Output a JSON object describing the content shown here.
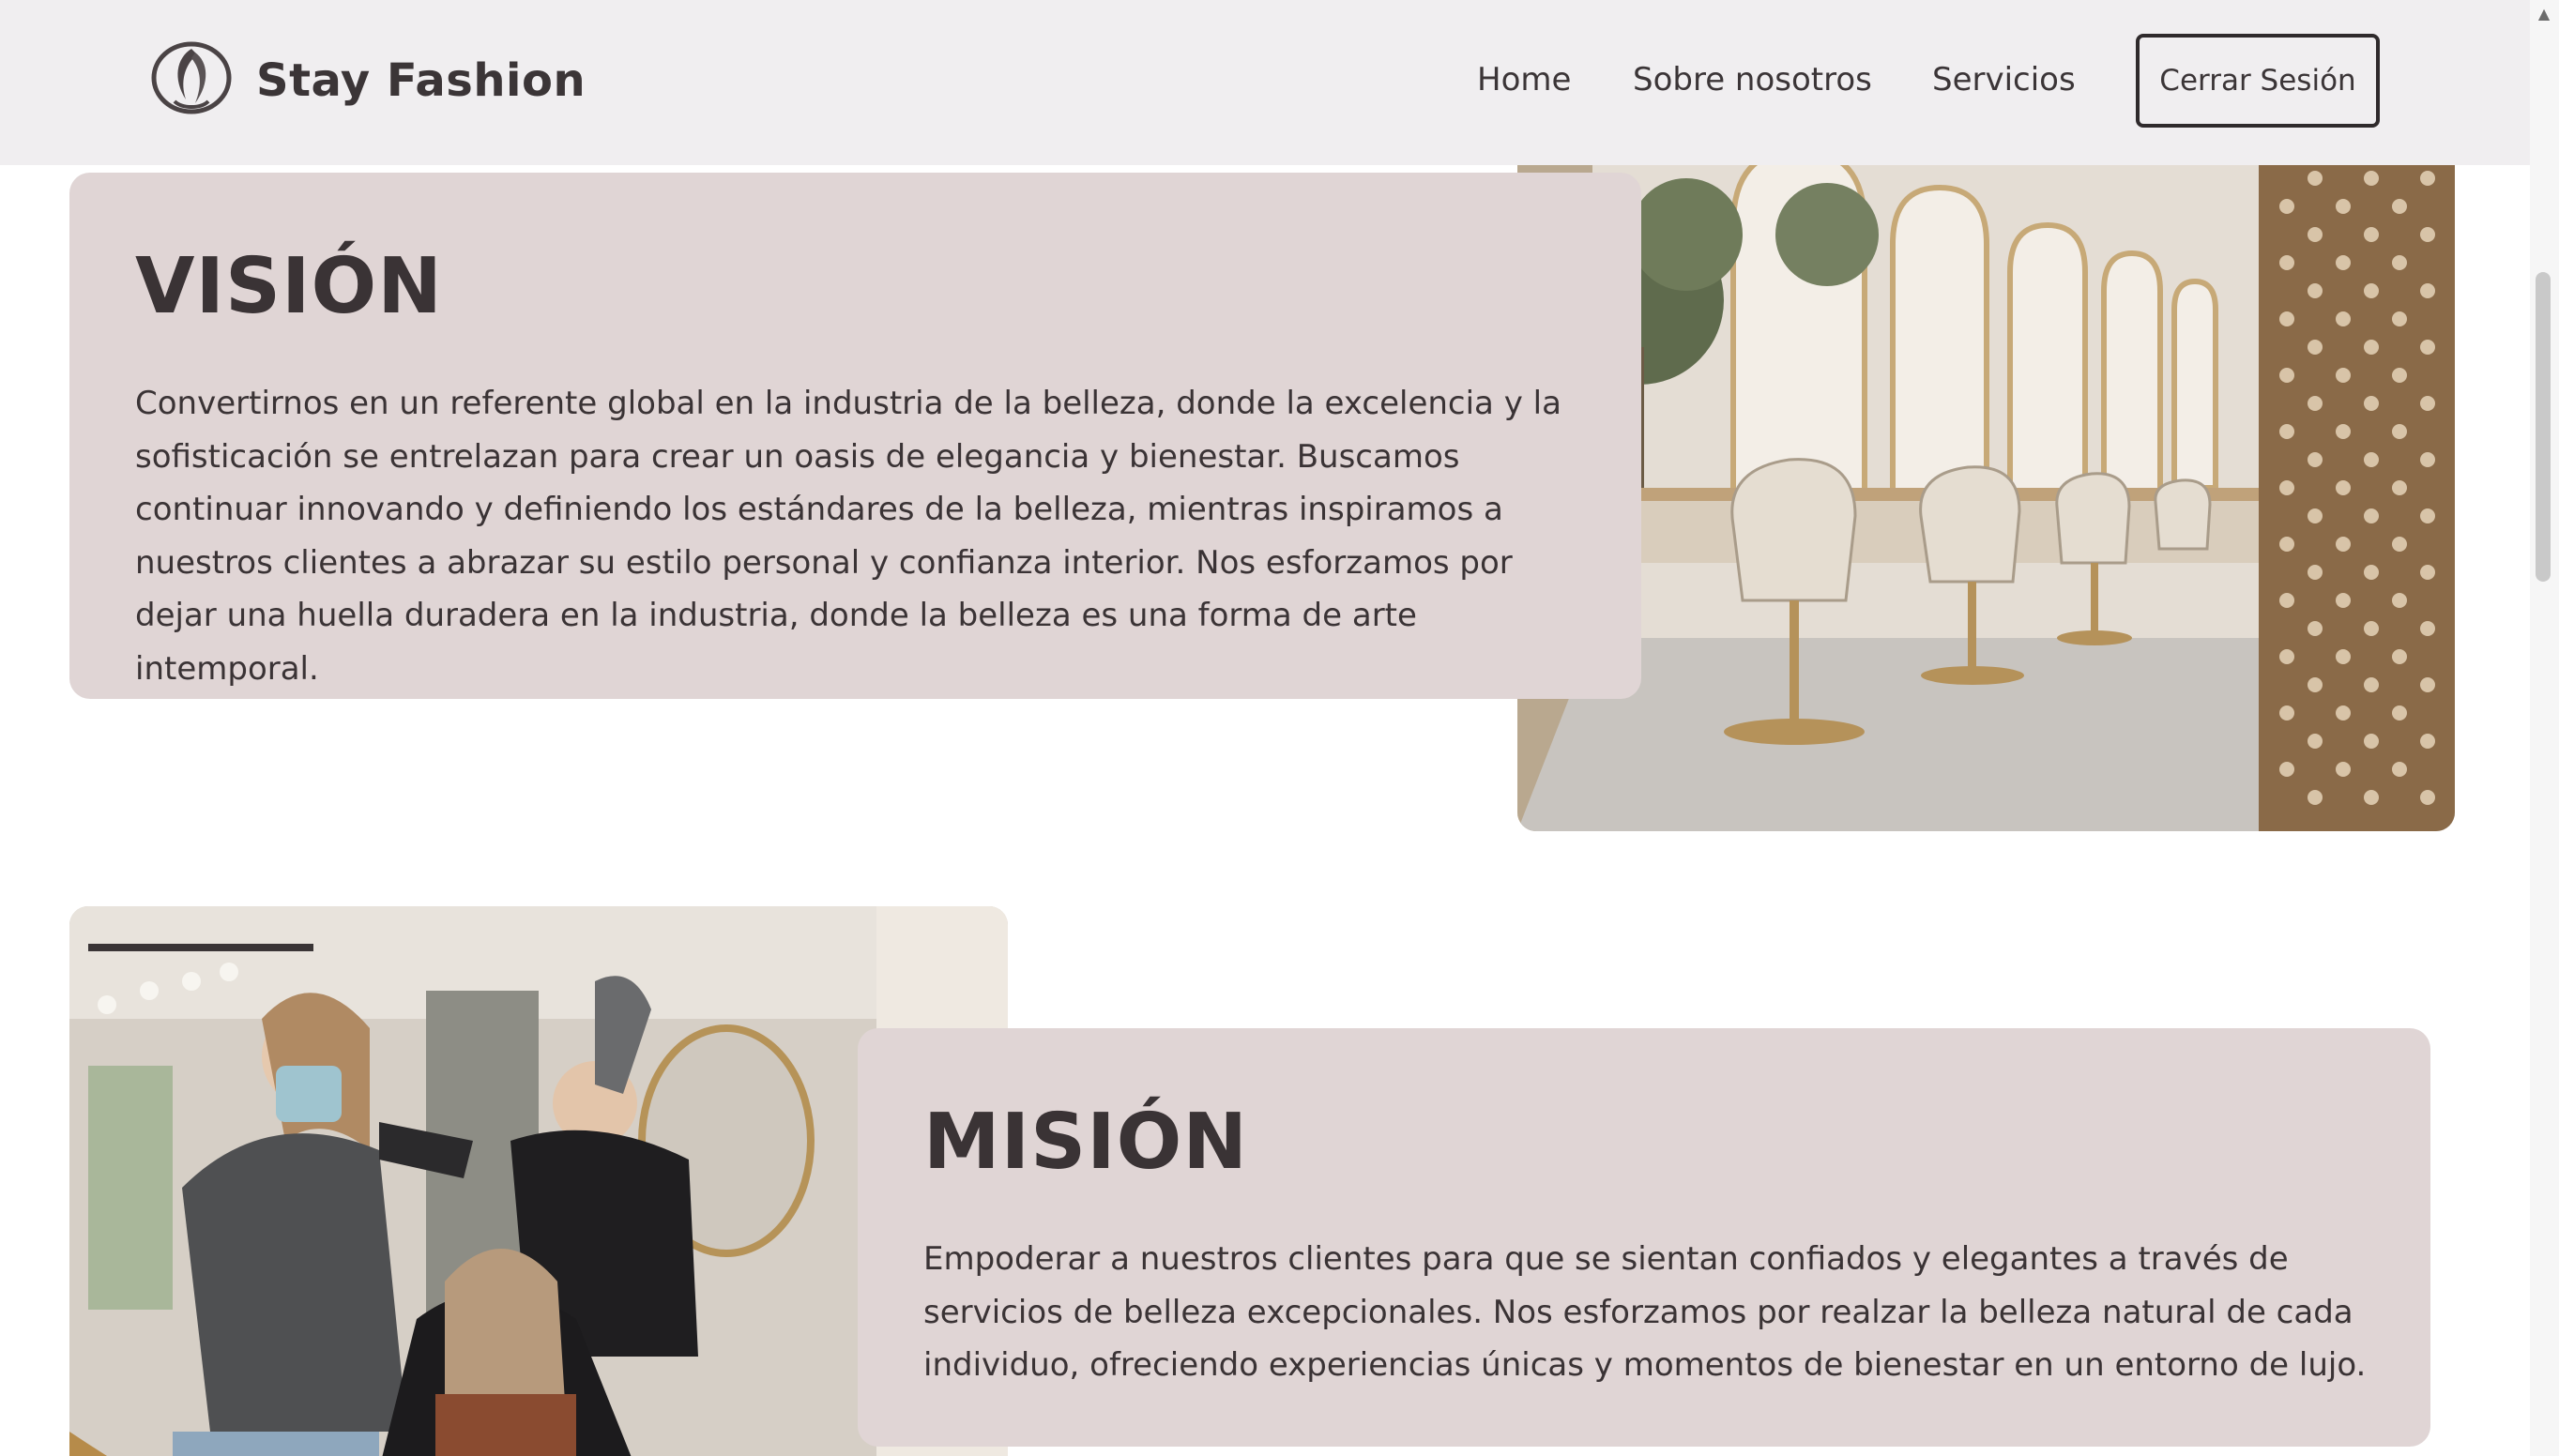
{
  "navbar": {
    "brand": "Stay Fashion",
    "logo_icon": "leaf-face-logo",
    "links": [
      "Home",
      "Sobre nosotros",
      "Servicios"
    ],
    "logout_label": "Cerrar Sesión",
    "background": "#f0eef0"
  },
  "vision": {
    "title": "VISIÓN",
    "text": "Convertirnos en un referente global en la industria de la belleza, donde la excelencia y la sofisticación se entrelazan para crear un oasis de elegancia y bienestar. Buscamos continuar innovando y definiendo los estándares de la belleza, mientras inspiramos a nuestros clientes a abrazar su estilo personal y confianza interior. Nos esforzamos por dejar una huella duradera en la industria, donde la belleza es una forma de arte intemporal."
  },
  "mision": {
    "title": "MISIÓN",
    "text": "Empoderar a nuestros clientes para que se sientan confiados y elegantes a través de servicios de belleza excepcionales. Nos esforzamos por realzar la belleza natural de cada individuo, ofreciendo experiencias únicas y momentos de bienestar en un entorno de lujo."
  },
  "colors": {
    "card_background": "#e0d5d5",
    "text": "#3a3335",
    "page_background": "#ffffff"
  }
}
